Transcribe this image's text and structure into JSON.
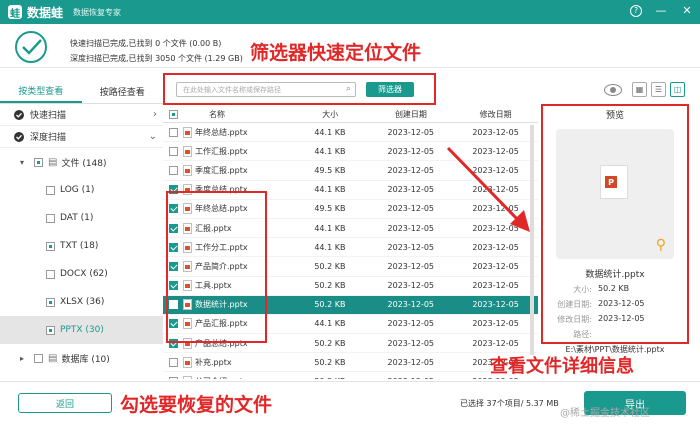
{
  "titlebar": {
    "logo_glyph": "蛙",
    "app_name": "数据蛙",
    "subtitle": "数据恢复专家"
  },
  "scan": {
    "line1": "快速扫描已完成,已找到 0 个文件 (0.00  B)",
    "line2": "深度扫描已完成,已找到 3050 个文件 (1.29 GB)"
  },
  "annotations": {
    "filter": "筛选器快速定位文件",
    "select": "勾选要恢复的文件",
    "details": "查看文件详细信息"
  },
  "sidebar": {
    "tab_type": "按类型查看",
    "tab_path": "按路径查看",
    "quick_scan": "快速扫描",
    "deep_scan": "深度扫描",
    "tree": [
      {
        "label": "文件 (148)",
        "indent": 1,
        "expand": "▾",
        "state": "partial",
        "folder": true
      },
      {
        "label": "LOG (1)",
        "indent": 2,
        "state": "off"
      },
      {
        "label": "DAT (1)",
        "indent": 2,
        "state": "off"
      },
      {
        "label": "TXT (18)",
        "indent": 2,
        "state": "partial"
      },
      {
        "label": "DOCX (62)",
        "indent": 2,
        "state": "off"
      },
      {
        "label": "XLSX (36)",
        "indent": 2,
        "state": "partial"
      },
      {
        "label": "PPTX (30)",
        "indent": 2,
        "state": "partial",
        "selected": true
      },
      {
        "label": "数据库 (10)",
        "indent": 1,
        "expand": "▸",
        "state": "off",
        "folder": true
      }
    ]
  },
  "search": {
    "placeholder": "在此处输入文件名称或保存路径",
    "filter_label": "筛选器"
  },
  "table": {
    "headers": [
      "名称",
      "大小",
      "创建日期",
      "修改日期"
    ],
    "rows": [
      {
        "checked": false,
        "name": "年终总结.pptx",
        "size": "44.1 KB",
        "created": "2023-12-05",
        "modified": "2023-12-05"
      },
      {
        "checked": false,
        "name": "工作汇报.pptx",
        "size": "44.1 KB",
        "created": "2023-12-05",
        "modified": "2023-12-05"
      },
      {
        "checked": false,
        "name": "季度汇报.pptx",
        "size": "49.5 KB",
        "created": "2023-12-05",
        "modified": "2023-12-05"
      },
      {
        "checked": true,
        "name": "季度总结.pptx",
        "size": "44.1 KB",
        "created": "2023-12-05",
        "modified": "2023-12-05"
      },
      {
        "checked": true,
        "name": "年终总结.pptx",
        "size": "49.5 KB",
        "created": "2023-12-05",
        "modified": "2023-12-05"
      },
      {
        "checked": true,
        "name": "汇报.pptx",
        "size": "44.1 KB",
        "created": "2023-12-05",
        "modified": "2023-12-05"
      },
      {
        "checked": true,
        "name": "工作分工.pptx",
        "size": "44.1 KB",
        "created": "2023-12-05",
        "modified": "2023-12-05"
      },
      {
        "checked": true,
        "name": "产品简介.pptx",
        "size": "50.2 KB",
        "created": "2023-12-05",
        "modified": "2023-12-05"
      },
      {
        "checked": true,
        "name": "工具.pptx",
        "size": "50.2 KB",
        "created": "2023-12-05",
        "modified": "2023-12-05"
      },
      {
        "checked": true,
        "name": "数据统计.pptx",
        "size": "50.2 KB",
        "created": "2023-12-05",
        "modified": "2023-12-05",
        "selected": true
      },
      {
        "checked": true,
        "name": "产品汇报.pptx",
        "size": "44.1 KB",
        "created": "2023-12-05",
        "modified": "2023-12-05"
      },
      {
        "checked": true,
        "name": "产品总结.pptx",
        "size": "50.2 KB",
        "created": "2023-12-05",
        "modified": "2023-12-05"
      },
      {
        "checked": false,
        "name": "补充.pptx",
        "size": "50.2 KB",
        "created": "2023-12-05",
        "modified": "2023-12-05"
      },
      {
        "checked": false,
        "name": "公司介绍.pptx",
        "size": "50.2 KB",
        "created": "2023-12-05",
        "modified": "2023-12-05"
      }
    ]
  },
  "preview": {
    "title": "预览",
    "file_name": "数据统计.pptx",
    "size_label": "大小:",
    "size": "50.2 KB",
    "created_label": "创建日期:",
    "created": "2023-12-05",
    "modified_label": "修改日期:",
    "modified": "2023-12-05",
    "path_label": "路径:",
    "path": "E:\\素材\\PPT\\数据统计.pptx"
  },
  "footer": {
    "back": "返回",
    "selected_info": "已选择 37个项目/ 5.37 MB",
    "export": "导出",
    "watermark": "@稀土掘金技术社区"
  },
  "colors": {
    "accent": "#1a9a8e",
    "annotation": "#e02828"
  }
}
